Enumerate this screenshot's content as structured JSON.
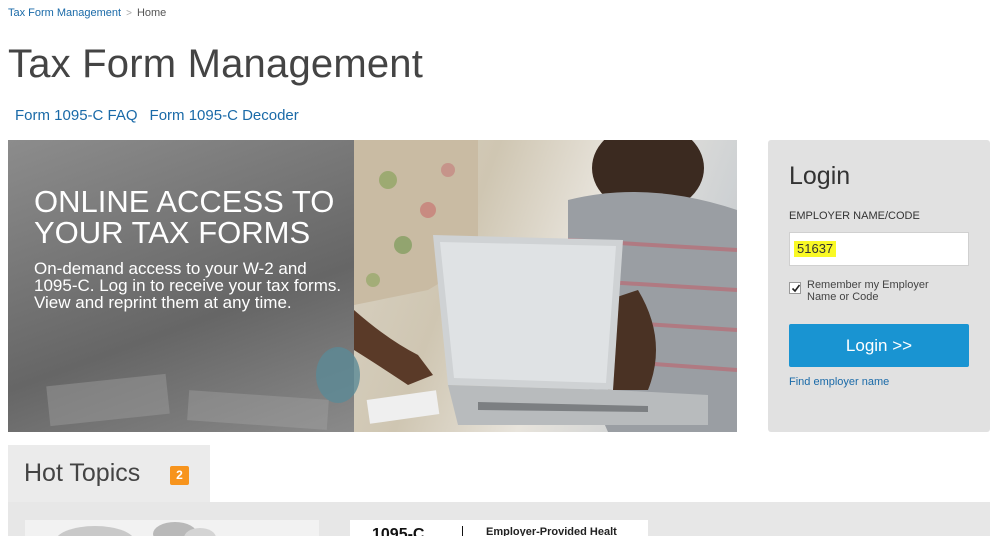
{
  "breadcrumb": {
    "root": "Tax Form Management",
    "separator": ">",
    "current": "Home"
  },
  "page": {
    "title": "Tax Form Management"
  },
  "sublinks": [
    {
      "label": "Form 1095-C FAQ"
    },
    {
      "label": "Form 1095-C Decoder"
    }
  ],
  "hero": {
    "headline": "ONLINE ACCESS TO YOUR TAX FORMS",
    "description": "On-demand access to your W-2 and 1095-C. Log in to receive your tax forms. View and reprint them at any time."
  },
  "login": {
    "title": "Login",
    "field_label": "EMPLOYER NAME/CODE",
    "field_value": "51637",
    "remember_label": "Remember my Employer Name or Code",
    "remember_checked": true,
    "button_label": "Login >>",
    "find_link": "Find employer name"
  },
  "hot_topics": {
    "title": "Hot Topics",
    "count": "2",
    "cards": [
      {
        "form_label": "1095-C",
        "title": "Employer-Provided Healt"
      }
    ]
  },
  "colors": {
    "link": "#1a6aa8",
    "button": "#1994d2",
    "badge": "#f7941d",
    "highlight": "#f9f925",
    "panel": "#e1e1e1"
  }
}
